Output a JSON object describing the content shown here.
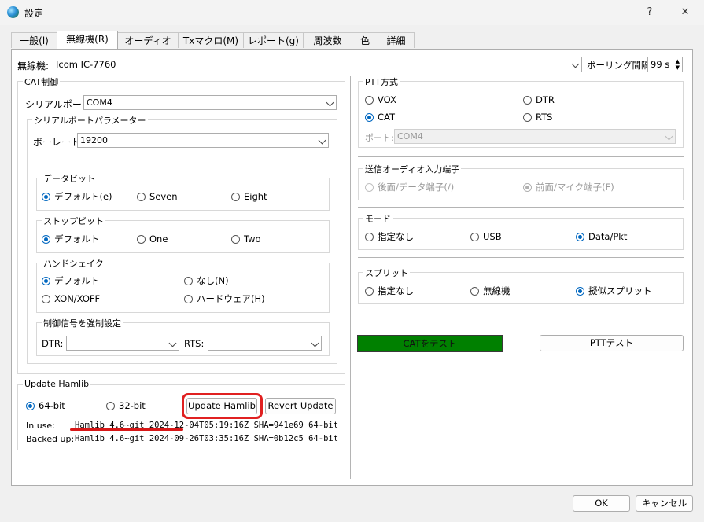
{
  "window": {
    "title": "設定",
    "help_glyph": "?",
    "close_glyph": "✕"
  },
  "tabs": [
    {
      "label": "一般(l)"
    },
    {
      "label": "無線機(R)"
    },
    {
      "label": "オーディオ(u)"
    },
    {
      "label": "Txマクロ(M)"
    },
    {
      "label": "レポート(g)"
    },
    {
      "label": "周波数"
    },
    {
      "label": "色"
    },
    {
      "label": "詳細"
    }
  ],
  "radio": {
    "label": "無線機:",
    "value": "Icom IC-7760",
    "poll_label": "ポーリング間隔:",
    "poll_value": "99 s"
  },
  "cat": {
    "title": "CAT制御",
    "serial_port_label": "シリアルポート:",
    "serial_port_value": "COM4",
    "params_title": "シリアルポートパラメーター",
    "baud_label": "ボーレート:",
    "baud_value": "19200",
    "data_bits": {
      "title": "データビット",
      "options": [
        "デフォルト(e)",
        "Seven",
        "Eight"
      ]
    },
    "stop_bits": {
      "title": "ストップビット",
      "options": [
        "デフォルト",
        "One",
        "Two"
      ]
    },
    "handshake": {
      "title": "ハンドシェイク",
      "options": [
        "デフォルト",
        "なし(N)",
        "XON/XOFF",
        "ハードウェア(H)"
      ]
    },
    "force": {
      "title": "制御信号を強制設定",
      "dtr_label": "DTR:",
      "rts_label": "RTS:"
    }
  },
  "hamlib": {
    "title": "Update Hamlib",
    "opt64": "64-bit",
    "opt32": "32-bit",
    "update_btn": "Update Hamlib",
    "revert_btn": "Revert Update",
    "inuse_label": "In use:",
    "inuse_value": "Hamlib 4.6~git 2024-12-04T05:19:16Z SHA=941e69 64-bit",
    "backup_label": "Backed up:",
    "backup_value": "Hamlib 4.6~git 2024-09-26T03:35:16Z SHA=0b12c5 64-bit"
  },
  "ptt": {
    "title": "PTT方式",
    "options": [
      "VOX",
      "DTR",
      "CAT",
      "RTS"
    ],
    "port_label": "ポート:",
    "port_value": "COM4"
  },
  "tx_audio": {
    "title": "送信オーディオ入力端子",
    "options": [
      "後面/データ端子(/)",
      "前面/マイク端子(F)"
    ]
  },
  "mode": {
    "title": "モード",
    "options": [
      "指定なし",
      "USB",
      "Data/Pkt"
    ]
  },
  "split": {
    "title": "スプリット",
    "options": [
      "指定なし",
      "無線機",
      "擬似スプリット"
    ]
  },
  "buttons": {
    "test_cat": "CATをテスト",
    "test_ptt": "PTTテスト",
    "ok": "OK",
    "cancel": "キャンセル"
  },
  "colors": {
    "accent": "#0067c0",
    "cat_ok": "#008000",
    "highlight": "#e02020"
  }
}
